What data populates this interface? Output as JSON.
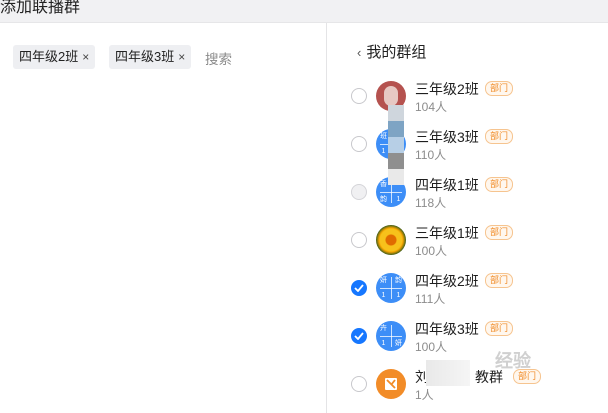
{
  "window": {
    "title": "添加联播群"
  },
  "selected_chips": [
    {
      "label": "四年级2班",
      "remove_glyph": "×"
    },
    {
      "label": "四年级3班",
      "remove_glyph": "×"
    }
  ],
  "search": {
    "placeholder": "搜索"
  },
  "right_panel": {
    "back_glyph": "‹",
    "heading": "我的群组"
  },
  "groups": [
    {
      "name": "三年级2班",
      "count": "104人",
      "badge": "部门",
      "state": "unchecked",
      "avatar": "photo-red"
    },
    {
      "name": "三年级3班",
      "count": "110人",
      "badge": "部门",
      "state": "unchecked",
      "avatar": "grid-blue",
      "avatar_text": [
        "班",
        "",
        "1",
        ""
      ]
    },
    {
      "name": "四年级1班",
      "count": "118人",
      "badge": "部门",
      "state": "disabled",
      "avatar": "grid-blue",
      "avatar_text": [
        "香",
        "",
        "韵",
        "1"
      ]
    },
    {
      "name": "三年级1班",
      "count": "100人",
      "badge": "部门",
      "state": "unchecked",
      "avatar": "photo-flower"
    },
    {
      "name": "四年级2班",
      "count": "111人",
      "badge": "部门",
      "state": "checked",
      "avatar": "grid-blue",
      "avatar_text": [
        "妍",
        "韵",
        "1",
        "1"
      ]
    },
    {
      "name": "四年级3班",
      "count": "100人",
      "badge": "部门",
      "state": "checked",
      "avatar": "grid-blue",
      "avatar_text": [
        "卉",
        "",
        "1",
        "妍"
      ]
    },
    {
      "name": "刘",
      "name_tail": "教群",
      "count": "1人",
      "badge": "部门",
      "state": "unchecked",
      "avatar": "orange-logo"
    }
  ],
  "watermark": "经验",
  "colors": {
    "accent": "#1677ff",
    "badge": "#f08a24",
    "avatar_blue": "#3d8ef7"
  }
}
